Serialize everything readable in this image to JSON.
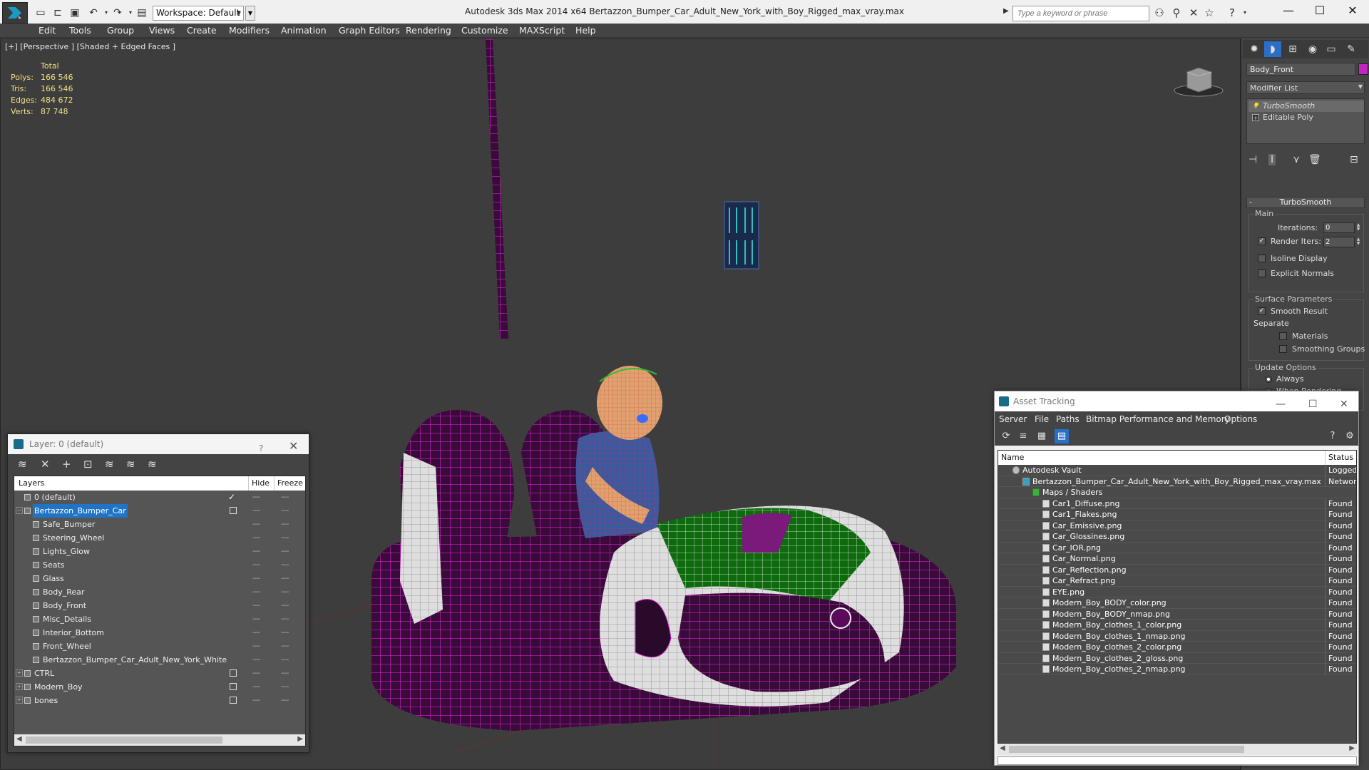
{
  "titlebar": {
    "workspace": "Workspace: Default",
    "title": "Autodesk 3ds Max  2014 x64      Bertazzon_Bumper_Car_Adult_New_York_with_Boy_Rigged_max_vray.max",
    "search_placeholder": "Type a keyword or phrase"
  },
  "menu": [
    "Edit",
    "Tools",
    "Group",
    "Views",
    "Create",
    "Modifiers",
    "Animation",
    "Graph Editors",
    "Rendering",
    "Customize",
    "MAXScript",
    "Help"
  ],
  "viewport": {
    "label": "[+] [Perspective ] [Shaded + Edged Faces ]",
    "stats_header": "Total",
    "stats": [
      {
        "label": "Polys:",
        "value": "166 546"
      },
      {
        "label": "Tris:",
        "value": "166 546"
      },
      {
        "label": "Edges:",
        "value": "484 672"
      },
      {
        "label": "Verts:",
        "value": "87 748"
      }
    ]
  },
  "command_panel": {
    "object_name": "Body_Front",
    "object_color": "#c424c4",
    "modifier_list": "Modifier List",
    "stack": [
      "TurboSmooth",
      "Editable Poly"
    ],
    "rollout_title": "TurboSmooth",
    "main_group": "Main",
    "iterations_label": "Iterations:",
    "iterations_value": "0",
    "render_iters_label": "Render Iters:",
    "render_iters_value": "2",
    "render_iters_checked": "✓",
    "isoline": "Isoline Display",
    "explicit_normals": "Explicit Normals",
    "surface_group": "Surface Parameters",
    "smooth_result": "Smooth Result",
    "smooth_result_checked": "✓",
    "separate": "Separate",
    "materials": "Materials",
    "smoothing_groups": "Smoothing Groups",
    "update_group": "Update Options",
    "always": "Always",
    "when_rendering": "When Rendering"
  },
  "layer_panel": {
    "title": "Layer: 0 (default)",
    "help": "?",
    "col_layers": "Layers",
    "col_hide": "Hide",
    "col_freeze": "Freeze",
    "dash": "----",
    "check": "✓",
    "rows": [
      {
        "name": "0 (default)",
        "indent": 0,
        "check": true,
        "expander": ""
      },
      {
        "name": "Bertazzon_Bumper_Car",
        "indent": 0,
        "selected": true,
        "box": true,
        "expander": "−"
      },
      {
        "name": "Safe_Bumper",
        "indent": 1
      },
      {
        "name": "Steering_Wheel",
        "indent": 1
      },
      {
        "name": "Lights_Glow",
        "indent": 1
      },
      {
        "name": "Seats",
        "indent": 1
      },
      {
        "name": "Glass",
        "indent": 1
      },
      {
        "name": "Body_Rear",
        "indent": 1
      },
      {
        "name": "Body_Front",
        "indent": 1
      },
      {
        "name": "Misc_Details",
        "indent": 1
      },
      {
        "name": "Interior_Bottom",
        "indent": 1
      },
      {
        "name": "Front_Wheel",
        "indent": 1
      },
      {
        "name": "Bertazzon_Bumper_Car_Adult_New_York_White",
        "indent": 1
      },
      {
        "name": "CTRL",
        "indent": 0,
        "box": true,
        "expander": "+"
      },
      {
        "name": "Modern_Boy",
        "indent": 0,
        "box": true,
        "expander": "+"
      },
      {
        "name": "bones",
        "indent": 0,
        "box": true,
        "expander": "+"
      }
    ]
  },
  "asset_panel": {
    "title": "Asset Tracking",
    "menu": [
      "Server",
      "File",
      "Paths",
      "Bitmap Performance and Memory",
      "Options"
    ],
    "col_name": "Name",
    "col_status": "Status",
    "rows": [
      {
        "name": "Autodesk Vault",
        "status": "Logged Out",
        "indent": 1,
        "icon": "vault"
      },
      {
        "name": "Bertazzon_Bumper_Car_Adult_New_York_with_Boy_Rigged_max_vray.max",
        "status": "Network",
        "indent": 2,
        "icon": "max"
      },
      {
        "name": "Maps / Shaders",
        "status": "",
        "indent": 3,
        "icon": "maps"
      },
      {
        "name": "Car1_Diffuse.png",
        "status": "Found",
        "indent": 4
      },
      {
        "name": "Car1_Flakes.png",
        "status": "Found",
        "indent": 4
      },
      {
        "name": "Car_Emissive.png",
        "status": "Found",
        "indent": 4
      },
      {
        "name": "Car_Glossines.png",
        "status": "Found",
        "indent": 4
      },
      {
        "name": "Car_IOR.png",
        "status": "Found",
        "indent": 4
      },
      {
        "name": "Car_Normal.png",
        "status": "Found",
        "indent": 4
      },
      {
        "name": "Car_Reflection.png",
        "status": "Found",
        "indent": 4
      },
      {
        "name": "Car_Refract.png",
        "status": "Found",
        "indent": 4
      },
      {
        "name": "EYE.png",
        "status": "Found",
        "indent": 4
      },
      {
        "name": "Modern_Boy_BODY_color.png",
        "status": "Found",
        "indent": 4
      },
      {
        "name": "Modern_Boy_BODY_nmap.png",
        "status": "Found",
        "indent": 4
      },
      {
        "name": "Modern_Boy_clothes_1_color.png",
        "status": "Found",
        "indent": 4
      },
      {
        "name": "Modern_Boy_clothes_1_nmap.png",
        "status": "Found",
        "indent": 4
      },
      {
        "name": "Modern_Boy_clothes_2_color.png",
        "status": "Found",
        "indent": 4
      },
      {
        "name": "Modern_Boy_clothes_2_gloss.png",
        "status": "Found",
        "indent": 4
      },
      {
        "name": "Modern_Boy_clothes_2_nmap.png",
        "status": "Found",
        "indent": 4
      }
    ]
  }
}
